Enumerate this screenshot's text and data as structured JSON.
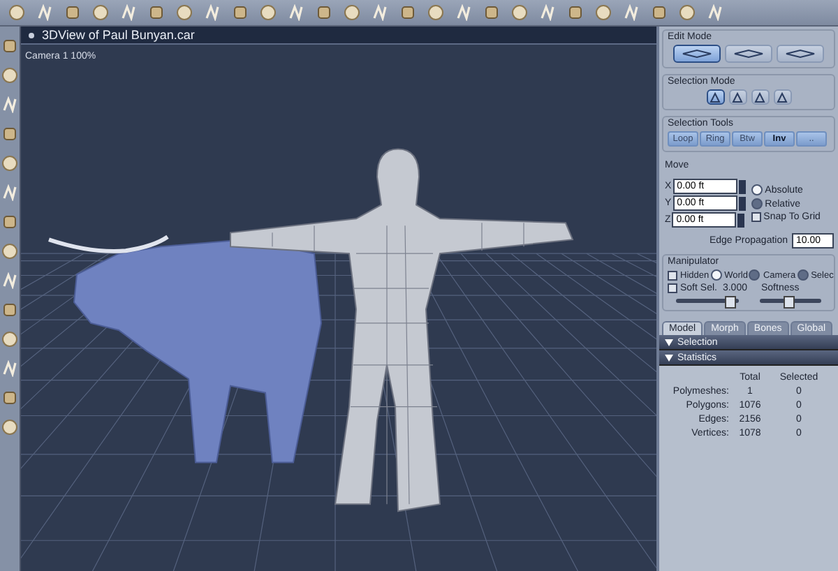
{
  "viewport": {
    "title": "3DView of Paul Bunyan.car",
    "camera_label": "Camera 1 100%"
  },
  "edit_mode": {
    "label": "Edit Mode",
    "buttons": [
      {
        "selected": true
      },
      {
        "selected": false
      },
      {
        "selected": false
      }
    ]
  },
  "selection_mode": {
    "label": "Selection Mode",
    "buttons": [
      {
        "selected": true
      },
      {
        "selected": false
      },
      {
        "selected": false
      },
      {
        "selected": false
      }
    ]
  },
  "selection_tools": {
    "label": "Selection Tools",
    "buttons": [
      {
        "label": "Loop",
        "disabled": true
      },
      {
        "label": "Ring",
        "disabled": true
      },
      {
        "label": "Btw",
        "disabled": true
      },
      {
        "label": "Inv",
        "disabled": false
      },
      {
        "label": "..",
        "disabled": true
      }
    ]
  },
  "move": {
    "label": "Move",
    "fields": [
      {
        "axis": "X",
        "value": "0.00 ft"
      },
      {
        "axis": "Y",
        "value": "0.00 ft"
      },
      {
        "axis": "Z",
        "value": "0.00 ft"
      }
    ],
    "options": [
      {
        "kind": "radio",
        "label": "Absolute",
        "selected": true
      },
      {
        "kind": "radio",
        "label": "Relative",
        "selected": false
      },
      {
        "kind": "checkbox",
        "label": "Snap To Grid",
        "checked": false
      }
    ]
  },
  "edge_propagation": {
    "label": "Edge Propagation",
    "value": "10.00"
  },
  "manipulator": {
    "label": "Manipulator",
    "options": [
      {
        "kind": "checkbox",
        "label": "Hidden",
        "checked": false
      },
      {
        "kind": "radio",
        "label": "World",
        "selected": true
      },
      {
        "kind": "radio",
        "label": "Camera",
        "selected": false
      },
      {
        "kind": "radio",
        "label": "Selec",
        "selected": false
      }
    ],
    "soft_selection": {
      "label": "Soft Sel.",
      "checked": false,
      "value": "3.000",
      "level": 0.85
    },
    "softness": {
      "label": "Softness",
      "level": 0.45
    }
  },
  "tabs": [
    {
      "label": "Model",
      "selected": true
    },
    {
      "label": "Morph",
      "selected": false
    },
    {
      "label": "Bones",
      "selected": false
    },
    {
      "label": "Global",
      "selected": false
    }
  ],
  "sections": [
    {
      "label": "Selection"
    },
    {
      "label": "Statistics"
    }
  ],
  "statistics": {
    "columns": [
      "Total",
      "Selected"
    ],
    "rows": [
      {
        "label": "Polymeshes:",
        "total": "1",
        "selected": "0"
      },
      {
        "label": "Polygons:",
        "total": "1076",
        "selected": "0"
      },
      {
        "label": "Edges:",
        "total": "2156",
        "selected": "0"
      },
      {
        "label": "Vertices:",
        "total": "1078",
        "selected": "0"
      }
    ]
  }
}
